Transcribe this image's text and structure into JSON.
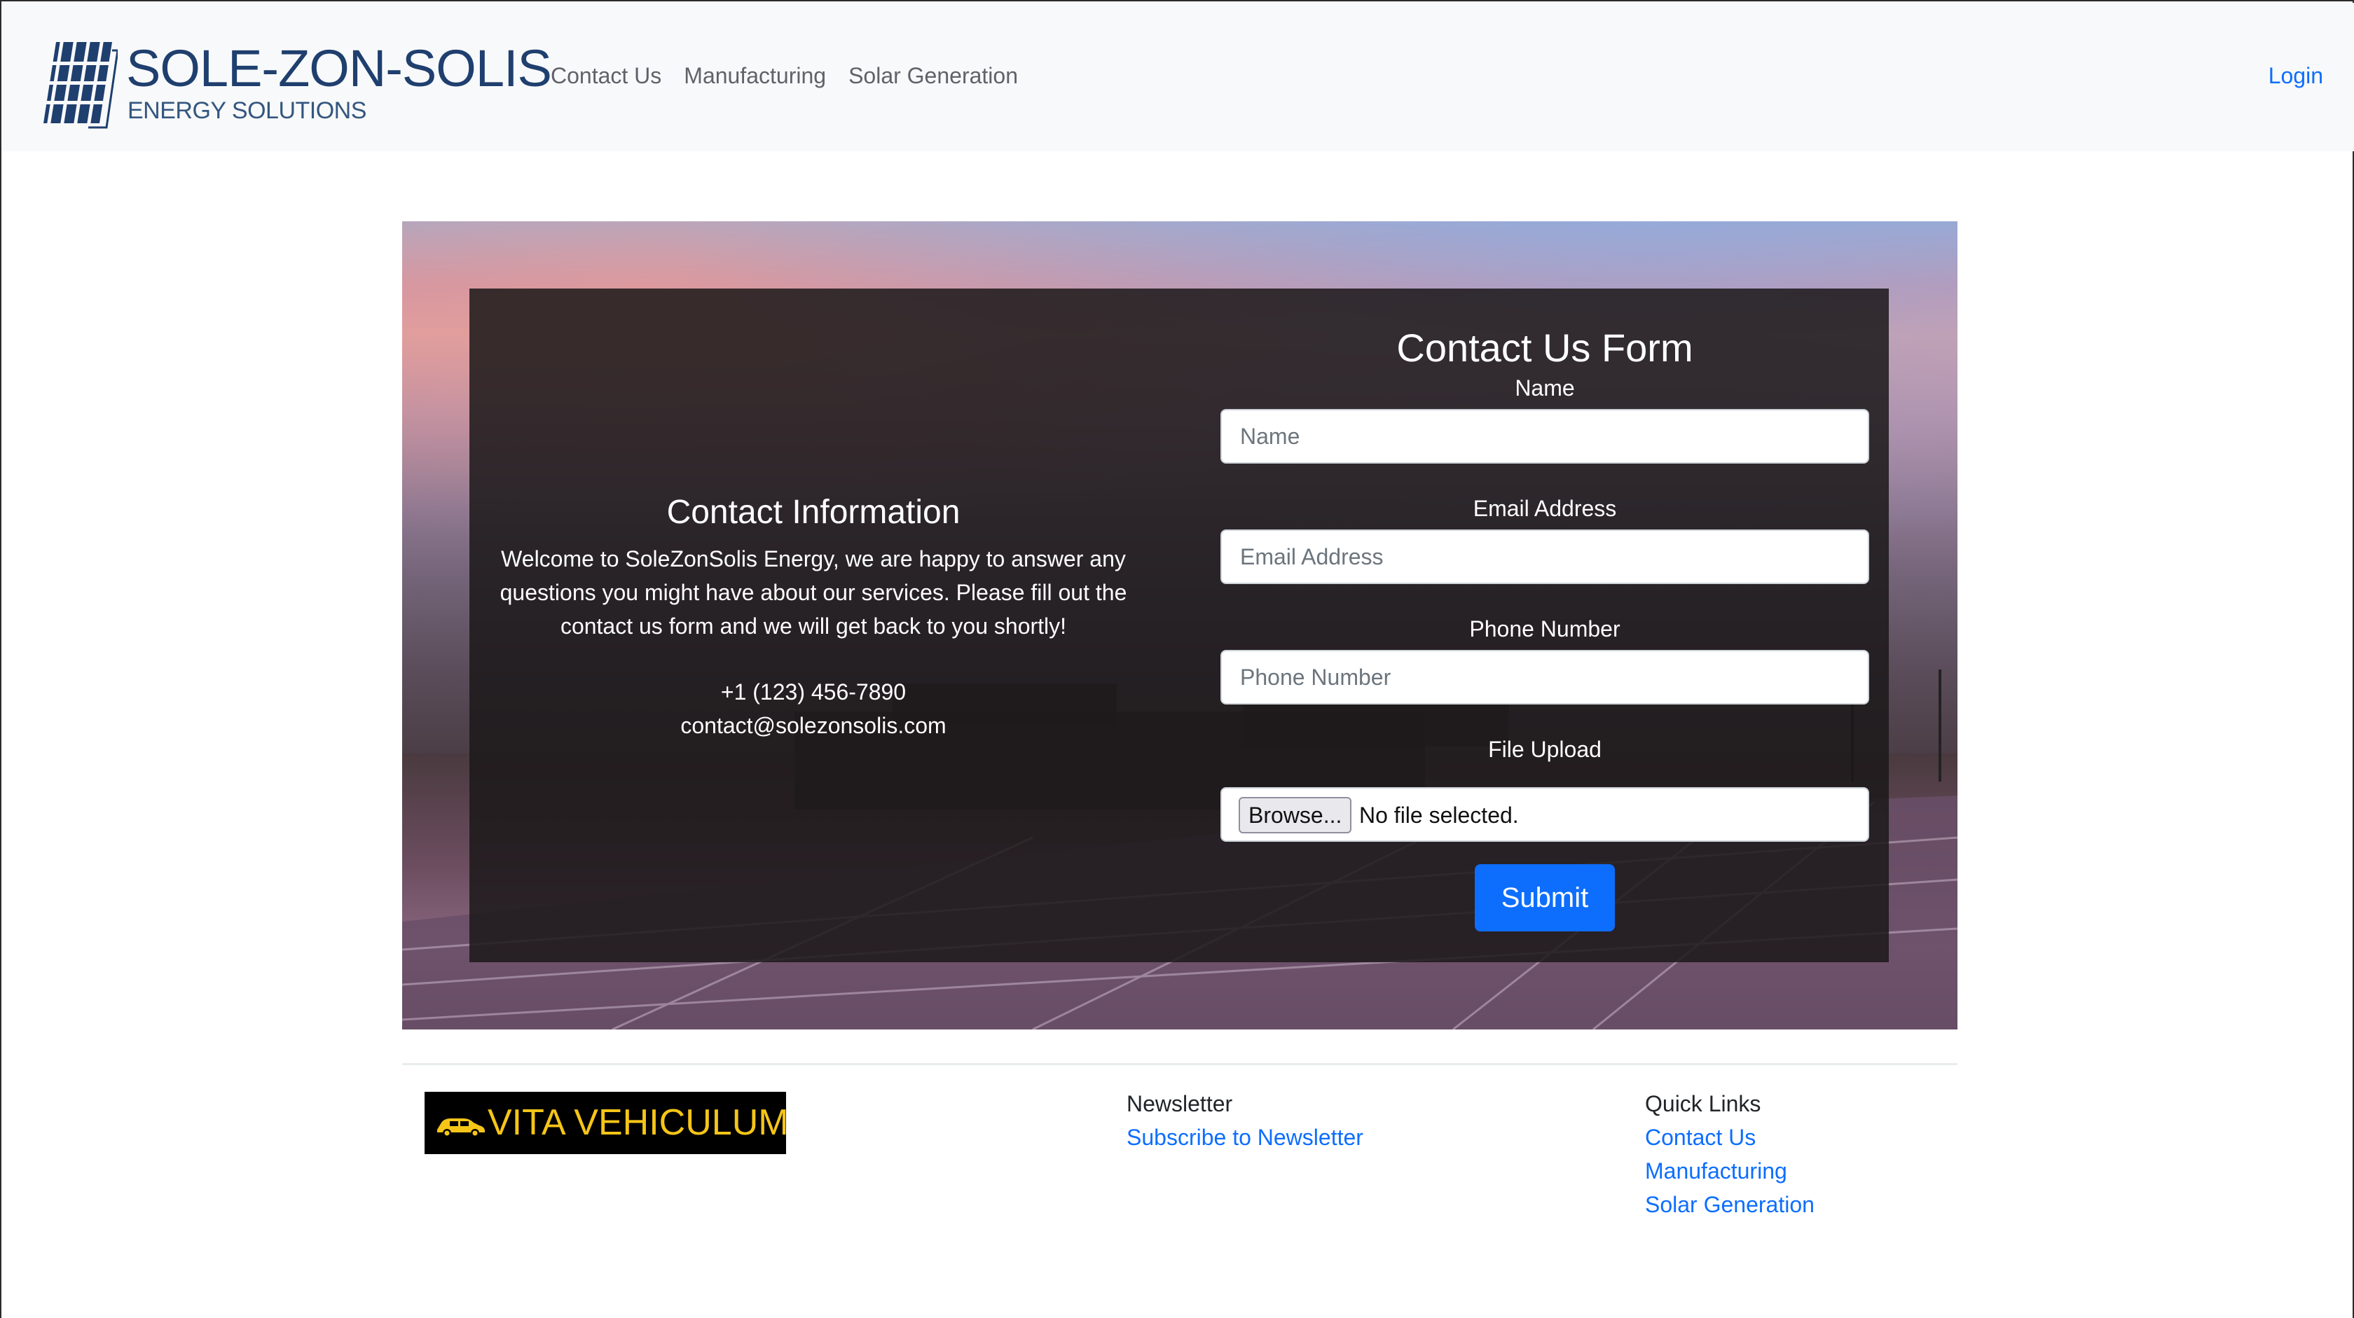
{
  "navbar": {
    "brand_name": "SOLE-ZON-SOLIS",
    "brand_tagline": "ENERGY SOLUTIONS",
    "links": [
      "Contact Us",
      "Manufacturing",
      "Solar Generation"
    ],
    "login": "Login"
  },
  "contact_info": {
    "title": "Contact Information",
    "text": "Welcome to SoleZonSolis Energy, we are happy to answer any questions you might have about our services. Please fill out the contact us form and we will get back to you shortly!",
    "phone": "+1 (123) 456-7890",
    "email": "contact@solezonsolis.com"
  },
  "form": {
    "title": "Contact Us Form",
    "name_label": "Name",
    "name_placeholder": "Name",
    "email_label": "Email Address",
    "email_placeholder": "Email Address",
    "phone_label": "Phone Number",
    "phone_placeholder": "Phone Number",
    "file_label": "File Upload",
    "browse_label": "Browse...",
    "file_status": "No file selected.",
    "submit_label": "Submit"
  },
  "footer": {
    "sponsor_text": "VITA VEHICULUM",
    "newsletter_heading": "Newsletter",
    "newsletter_link": "Subscribe to Newsletter",
    "quick_links_heading": "Quick Links",
    "quick_links": [
      "Contact Us",
      "Manufacturing",
      "Solar Generation"
    ]
  },
  "colors": {
    "brand": "#1f3f6e",
    "link": "#0d6efd",
    "navbar_bg": "#f8f9fa",
    "sponsor_text": "#f5c518"
  },
  "icons": {
    "brand_logo": "solar-panel-logo-icon",
    "sponsor_logo": "car-icon"
  }
}
